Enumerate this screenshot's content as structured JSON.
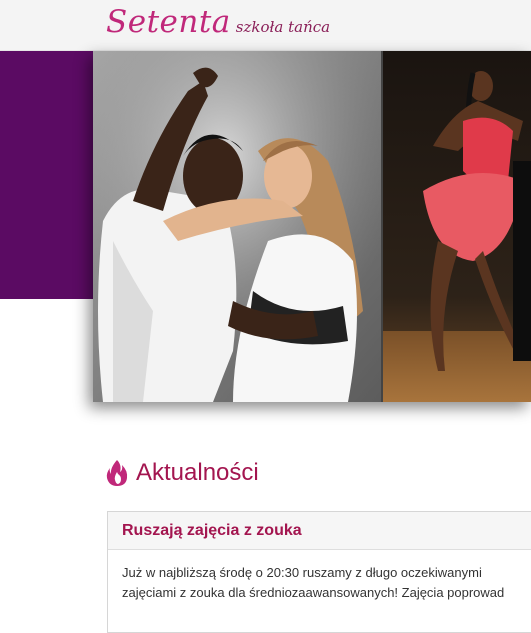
{
  "logo": {
    "name": "Setenta",
    "tagline": "szkoła tańca"
  },
  "section": {
    "title": "Aktualności",
    "icon": "flame-icon",
    "accent": "#a3154f"
  },
  "news": {
    "title": "Ruszają zajęcia z zouka",
    "line1": "Już w najbliższą środę o 20:30 ruszamy z długo oczekiwanymi",
    "line2": "zajęciami z zouka dla średniozaawansowanych! Zajęcia poprowad"
  },
  "colors": {
    "brand": "#c0287a",
    "purple_block": "#5b0b63"
  }
}
